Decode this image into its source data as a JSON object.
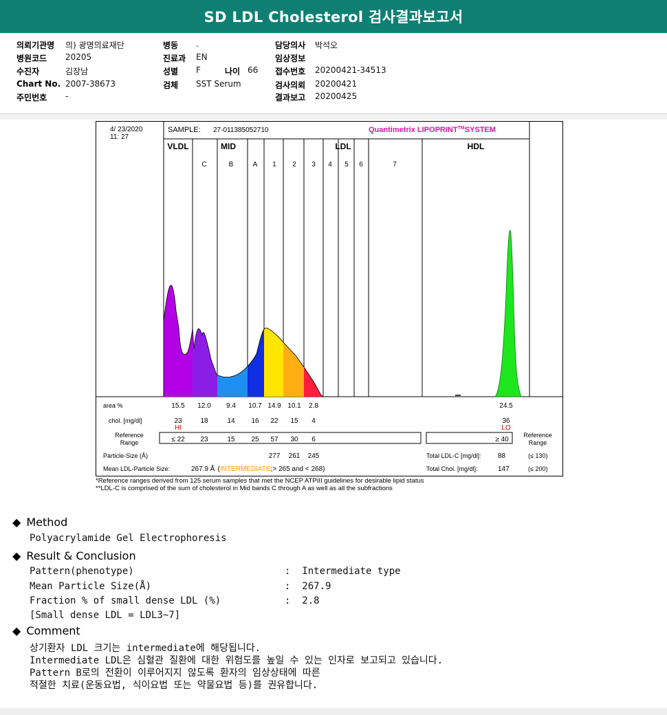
{
  "header": {
    "title": "SD LDL Cholesterol 검사결과보고서"
  },
  "info": {
    "col1": [
      {
        "label": "의뢰기관명",
        "value": "의) 광명의료재단"
      },
      {
        "label": "병원코드",
        "value": "20205"
      },
      {
        "label": "수진자",
        "value": "김장남"
      },
      {
        "label": "Chart No.",
        "value": "2007-38673"
      },
      {
        "label": "주민번호",
        "value": "-"
      }
    ],
    "col2": [
      {
        "label": "병동",
        "value": "."
      },
      {
        "label": "진료과",
        "value": "EN"
      },
      {
        "label": "성별",
        "value": "F"
      },
      {
        "label": "검체",
        "value": "SST Serum"
      }
    ],
    "age": {
      "label": "나이",
      "value": "66"
    },
    "col3": [
      {
        "label": "담당의사",
        "value": "박석오"
      },
      {
        "label": "임상정보",
        "value": ""
      },
      {
        "label": "접수번호",
        "value": "20200421-34513"
      },
      {
        "label": "검사의뢰",
        "value": "20200421"
      },
      {
        "label": "결과보고",
        "value": "20200425"
      }
    ]
  },
  "report": {
    "date": "4/ 23/2020",
    "time": "11: 27",
    "sample_label": "SAMPLE:",
    "sample_id": "27-011385052710",
    "brand": "Quantimetrix LIPOPRINT",
    "brand_tm": "TM",
    "brand_suffix": "SYSTEM",
    "groups": [
      "VLDL",
      "MID",
      "LDL",
      "HDL"
    ],
    "bands": [
      "C",
      "B",
      "A",
      "1",
      "2",
      "3",
      "4",
      "5",
      "6",
      "7"
    ],
    "rows": {
      "area_label": "area %",
      "area": [
        "15.5",
        "12.0",
        "9.4",
        "10.7",
        "14.9",
        "10.1",
        "2.8",
        "24.5"
      ],
      "chol_label": "chol. [mg/dl]",
      "chol": [
        "23",
        "18",
        "14",
        "16",
        "22",
        "15",
        "4",
        "36"
      ],
      "hi": "HI",
      "lo": "LO",
      "ref_label": [
        "Reference",
        "Range"
      ],
      "ref": [
        "≤ 22",
        "23",
        "15",
        "25",
        "57",
        "30",
        "6",
        "≥ 40"
      ],
      "ref_right_label": [
        "Reference",
        "Range"
      ],
      "particle_label": "Particle-Size (Å)",
      "particle": [
        "277",
        "261",
        "245"
      ],
      "total_ldl_label": "Total LDL-C [mg/dl]:",
      "total_ldl": "88",
      "total_ldl_ref": "(≤ 130)",
      "mean_label": "Mean LDL-Particle Size:",
      "mean_value": "267.9 Å",
      "mean_pre": "(",
      "mean_type": "INTERMEDIATE",
      "mean_post": ";> 265 and < 268)",
      "total_chol_label": "Total Chol. [mg/dl]:",
      "total_chol": "147",
      "total_chol_ref": "(≤ 200)"
    },
    "footnotes": [
      "*Reference ranges derived from 125 serum samples that met the NCEP ATPIII guidelines for desirable lipid status",
      "**LDL-C is comprised of the sum of cholesterol in Mid bands C through A as well as all the subfractions"
    ],
    "colors": {
      "vldl": "#b400e6",
      "C": "#8a1ee6",
      "B": "#1e8ff0",
      "A": "#0f2fe0",
      "L1": "#ffe600",
      "L2": "#ffae14",
      "L3": "#ff1e3c",
      "hdl": "#1ee61e",
      "brand": "#e014a0",
      "title_bar": "#0f7f74",
      "intermediate": "#ff9a00",
      "hi_lo": "#e00000"
    }
  },
  "method": {
    "title": "Method",
    "text": "Polyacrylamide Gel Electrophoresis"
  },
  "result": {
    "title": "Result & Conclusion",
    "lines": [
      {
        "k": "Pattern(phenotype)",
        "v": ":  Intermediate type"
      },
      {
        "k": "Mean Particle Size(Å)",
        "v": ":  267.9"
      },
      {
        "k": "Fraction % of small dense LDL (%)",
        "v": ":  2.8"
      },
      {
        "k": "[Small dense LDL = LDL3~7]",
        "v": ""
      }
    ]
  },
  "comment": {
    "title": "Comment",
    "lines": [
      "상기환자 LDL 크기는 intermediate에 해당됩니다.",
      "Intermediate LDL은 심혈관 질환에 대한 위험도를 높일 수 있는 인자로 보고되고 있습니다.",
      "Pattern B로의 전환이 이루어지지 않도록 환자의 임상상태에 따른",
      "적절한 치료(운동요법, 식이요법 또는 약물요법 등)를 권유합니다."
    ]
  }
}
